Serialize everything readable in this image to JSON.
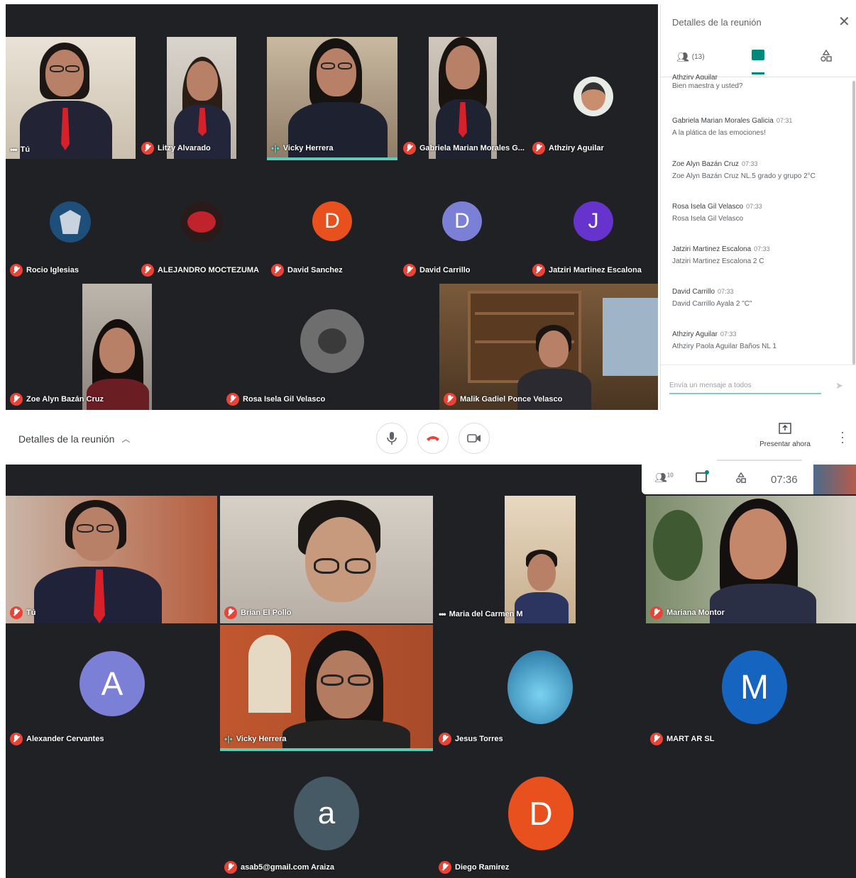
{
  "panel": {
    "title": "Detalles de la reunión",
    "people_count": "(13)",
    "partial_line_sender": "Athziry Aguilar",
    "partial_line_msg": "Bien maestra y usted?",
    "messages": [
      {
        "sender": "Gabriela Marian Morales Galicia",
        "time": "07:31",
        "text": "A la plática de las emociones!"
      },
      {
        "sender": "Zoe Alyn Bazán Cruz",
        "time": "07:33",
        "text": "Zoe Alyn Bazán Cruz NL.5 grado y grupo 2°C"
      },
      {
        "sender": "Rosa Isela Gil Velasco",
        "time": "07:33",
        "text": "Rosa Isela Gil Velasco"
      },
      {
        "sender": "Jatziri Martinez Escalona",
        "time": "07:33",
        "text": "Jatziri Martinez Escalona 2 C"
      },
      {
        "sender": "David Carrillo",
        "time": "07:33",
        "text": "David Carrillo Ayala 2 \"C\""
      },
      {
        "sender": "Athziry Aguilar",
        "time": "07:33",
        "text": "Athziry Paola Aguilar Baños NL 1"
      }
    ],
    "input_placeholder": "Envía un mensaje a todos"
  },
  "bar": {
    "meeting_details": "Detalles de la reunión",
    "present_now": "Presentar ahora"
  },
  "bottom_toolbar": {
    "people_badge": "10",
    "time": "07:36"
  },
  "top_tiles": {
    "t1": "Tú",
    "t2": "Litzy Alvarado",
    "t3": "Vicky Herrera",
    "t4": "Gabriela Marian Morales G...",
    "t5": "Athziry Aguilar",
    "t6": "Rocio Iglesias",
    "t7": "ALEJANDRO MOCTEZUMA",
    "t8": "David Sanchez",
    "t8_initial": "D",
    "t9": "David Carrillo",
    "t9_initial": "D",
    "t10": "Jatziri Martinez Escalona",
    "t10_initial": "J",
    "t11": "Zoe Alyn Bazán Cruz",
    "t12": "Rosa Isela Gil Velasco",
    "t13": "Malik Gadiel Ponce Velasco"
  },
  "bottom_tiles": {
    "b1": "Tú",
    "b2": "Brian El Pollo",
    "b3": "Maria del Carmen M",
    "b4": "Mariana Montor",
    "b5": "Alexander Cervantes",
    "b5_initial": "A",
    "b6": "Vicky Herrera",
    "b7": "Jesus Torres",
    "b8": "MART AR SL",
    "b8_initial": "M",
    "b9": "asab5@gmail.com Araiza",
    "b9_initial": "a",
    "b10": "Diego Ramirez",
    "b10_initial": "D"
  },
  "colors": {
    "grid_bg": "#202124",
    "mute_red": "#ea4335",
    "teal": "#00897b",
    "avatar_orange": "#e8501e",
    "avatar_lavender": "#7b7fd6",
    "avatar_purple": "#6633cc",
    "avatar_blue": "#1565c0",
    "avatar_slate": "#455a64"
  }
}
